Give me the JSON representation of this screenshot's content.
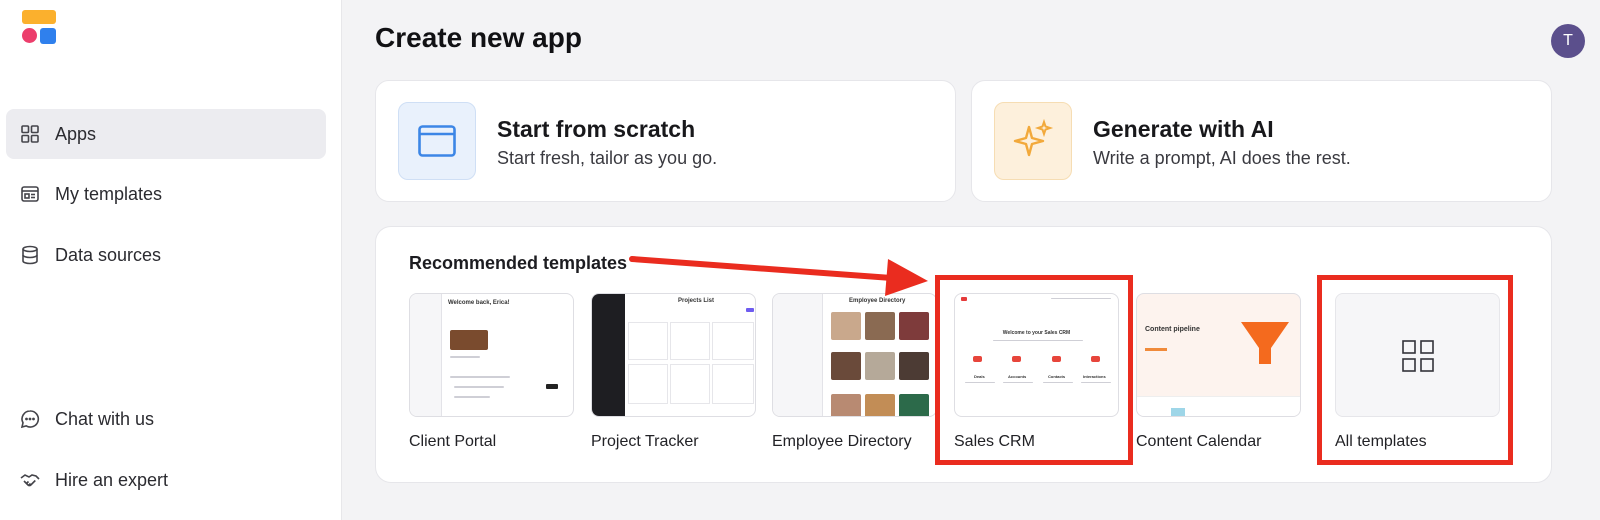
{
  "sidebar": {
    "items": [
      {
        "label": "Apps",
        "icon": "grid-icon",
        "active": true
      },
      {
        "label": "My templates",
        "icon": "templates-icon"
      },
      {
        "label": "Data sources",
        "icon": "database-icon"
      }
    ],
    "footer_items": [
      {
        "label": "Chat with us",
        "icon": "chat-icon"
      },
      {
        "label": "Hire an expert",
        "icon": "handshake-icon"
      }
    ]
  },
  "header": {
    "title": "Create new app",
    "avatar_initial": "T"
  },
  "options": [
    {
      "title": "Start from scratch",
      "subtitle": "Start fresh, tailor as you go.",
      "icon": "window-icon"
    },
    {
      "title": "Generate with AI",
      "subtitle": "Write a prompt, AI does the rest.",
      "icon": "sparkle-icon"
    }
  ],
  "templates": {
    "section_title": "Recommended templates",
    "items": [
      {
        "label": "Client Portal",
        "preview_heading": "Welcome back, Erica!"
      },
      {
        "label": "Project Tracker",
        "preview_heading": "Projects List"
      },
      {
        "label": "Employee Directory",
        "preview_heading": "Employee Directory"
      },
      {
        "label": "Sales CRM",
        "preview_heading": "Welcome to your Sales CRM",
        "preview_cols": [
          "Deals",
          "Accounts",
          "Contacts",
          "Interactions"
        ]
      },
      {
        "label": "Content Calendar",
        "preview_heading": "Content pipeline"
      },
      {
        "label": "All templates",
        "icon": "grid-icon"
      }
    ]
  },
  "colors": {
    "accent_annotation": "#ea2c1f",
    "logo_yellow": "#fbb02d",
    "logo_pink": "#ec3e6c",
    "logo_blue": "#2f80ed",
    "avatar": "#5b4f8c"
  }
}
